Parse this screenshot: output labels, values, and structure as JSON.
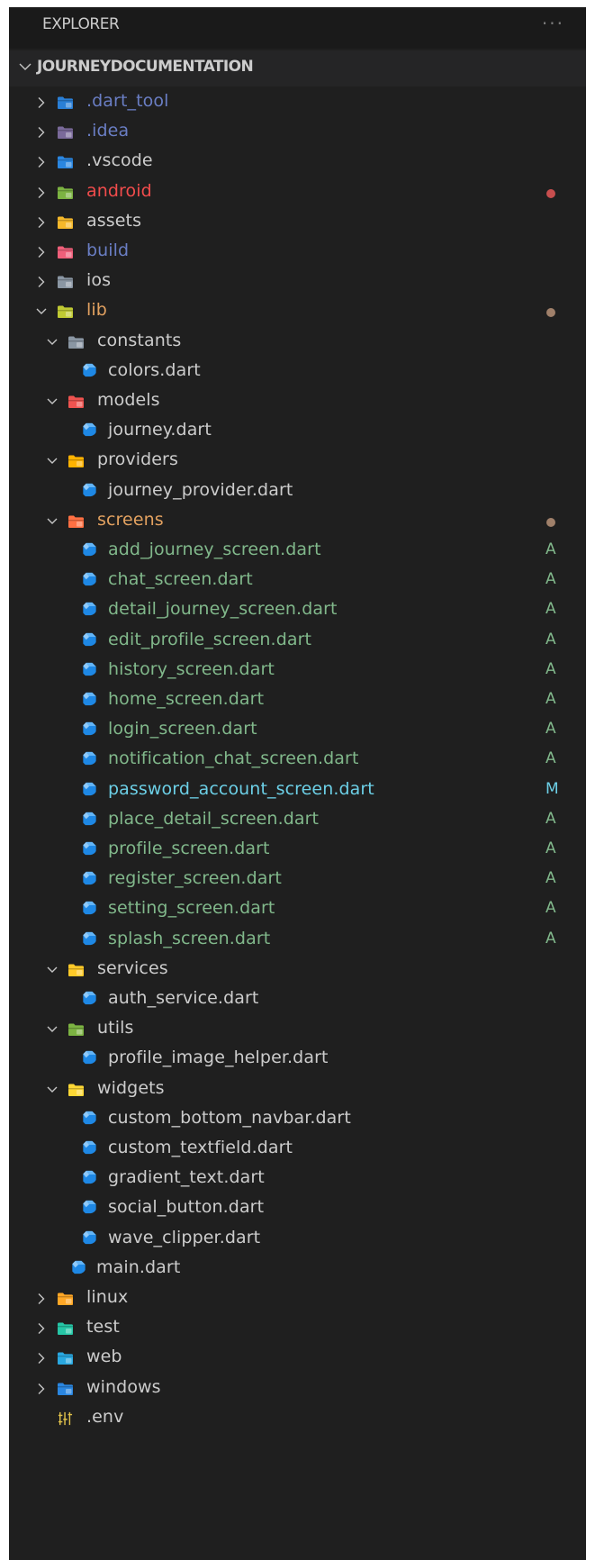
{
  "header": {
    "title": "EXPLORER",
    "more": "···"
  },
  "project": {
    "title": "JOURNEYDOCUMENTATION"
  },
  "colors": {
    "default": "#cccccc",
    "ignored": "#6a7ec4",
    "error": "#f14c4c",
    "modified_folder": "#e2a160",
    "added": "#81b88b",
    "modified": "#6ccfe6",
    "dot_error": "#c74e4e",
    "dot_modified": "#a0806a"
  },
  "tree": [
    {
      "label": ".dart_tool",
      "depth": 0,
      "folder": true,
      "expanded": false,
      "icon": "dart-tool-folder-icon",
      "icon_color": "#2a7fd6",
      "status": "ignored"
    },
    {
      "label": ".idea",
      "depth": 0,
      "folder": true,
      "expanded": false,
      "icon": "idea-folder-icon",
      "icon_color": "#7a6a9a",
      "status": "ignored"
    },
    {
      "label": ".vscode",
      "depth": 0,
      "folder": true,
      "expanded": false,
      "icon": "vscode-folder-icon",
      "icon_color": "#2a86e0",
      "status": "default"
    },
    {
      "label": "android",
      "depth": 0,
      "folder": true,
      "expanded": false,
      "icon": "android-folder-icon",
      "icon_color": "#7cb342",
      "status": "error",
      "dot": "dot_error"
    },
    {
      "label": "assets",
      "depth": 0,
      "folder": true,
      "expanded": false,
      "icon": "assets-folder-icon",
      "icon_color": "#f5b82a",
      "status": "default"
    },
    {
      "label": "build",
      "depth": 0,
      "folder": true,
      "expanded": false,
      "icon": "build-folder-icon",
      "icon_color": "#ef5f7a",
      "status": "ignored"
    },
    {
      "label": "ios",
      "depth": 0,
      "folder": true,
      "expanded": false,
      "icon": "ios-folder-icon",
      "icon_color": "#8a96a3",
      "status": "default"
    },
    {
      "label": "lib",
      "depth": 0,
      "folder": true,
      "expanded": true,
      "icon": "lib-folder-icon",
      "icon_color": "#c0ca33",
      "status": "modified_folder",
      "dot": "dot_modified"
    },
    {
      "label": "constants",
      "depth": 1,
      "folder": true,
      "expanded": true,
      "icon": "constants-folder-icon",
      "icon_color": "#8a96a3",
      "status": "default"
    },
    {
      "label": "colors.dart",
      "depth": 2,
      "folder": false,
      "icon": "dart-file-icon",
      "status": "default"
    },
    {
      "label": "models",
      "depth": 1,
      "folder": true,
      "expanded": true,
      "icon": "models-folder-icon",
      "icon_color": "#ef5350",
      "status": "default"
    },
    {
      "label": "journey.dart",
      "depth": 2,
      "folder": false,
      "icon": "dart-file-icon",
      "status": "default"
    },
    {
      "label": "providers",
      "depth": 1,
      "folder": true,
      "expanded": true,
      "icon": "providers-folder-icon",
      "icon_color": "#ffb300",
      "status": "default"
    },
    {
      "label": "journey_provider.dart",
      "depth": 2,
      "folder": false,
      "icon": "dart-file-icon",
      "status": "default"
    },
    {
      "label": "screens",
      "depth": 1,
      "folder": true,
      "expanded": true,
      "icon": "screens-folder-icon",
      "icon_color": "#ff7043",
      "status": "modified_folder",
      "dot": "dot_modified"
    },
    {
      "label": "add_journey_screen.dart",
      "depth": 2,
      "folder": false,
      "icon": "dart-file-icon",
      "status": "added",
      "badge": "A"
    },
    {
      "label": "chat_screen.dart",
      "depth": 2,
      "folder": false,
      "icon": "dart-file-icon",
      "status": "added",
      "badge": "A"
    },
    {
      "label": "detail_journey_screen.dart",
      "depth": 2,
      "folder": false,
      "icon": "dart-file-icon",
      "status": "added",
      "badge": "A"
    },
    {
      "label": "edit_profile_screen.dart",
      "depth": 2,
      "folder": false,
      "icon": "dart-file-icon",
      "status": "added",
      "badge": "A"
    },
    {
      "label": "history_screen.dart",
      "depth": 2,
      "folder": false,
      "icon": "dart-file-icon",
      "status": "added",
      "badge": "A"
    },
    {
      "label": "home_screen.dart",
      "depth": 2,
      "folder": false,
      "icon": "dart-file-icon",
      "status": "added",
      "badge": "A"
    },
    {
      "label": "login_screen.dart",
      "depth": 2,
      "folder": false,
      "icon": "dart-file-icon",
      "status": "added",
      "badge": "A"
    },
    {
      "label": "notification_chat_screen.dart",
      "depth": 2,
      "folder": false,
      "icon": "dart-file-icon",
      "status": "added",
      "badge": "A"
    },
    {
      "label": "password_account_screen.dart",
      "depth": 2,
      "folder": false,
      "icon": "dart-file-icon",
      "status": "modified",
      "badge": "M"
    },
    {
      "label": "place_detail_screen.dart",
      "depth": 2,
      "folder": false,
      "icon": "dart-file-icon",
      "status": "added",
      "badge": "A"
    },
    {
      "label": "profile_screen.dart",
      "depth": 2,
      "folder": false,
      "icon": "dart-file-icon",
      "status": "added",
      "badge": "A"
    },
    {
      "label": "register_screen.dart",
      "depth": 2,
      "folder": false,
      "icon": "dart-file-icon",
      "status": "added",
      "badge": "A"
    },
    {
      "label": "setting_screen.dart",
      "depth": 2,
      "folder": false,
      "icon": "dart-file-icon",
      "status": "added",
      "badge": "A"
    },
    {
      "label": "splash_screen.dart",
      "depth": 2,
      "folder": false,
      "icon": "dart-file-icon",
      "status": "added",
      "badge": "A"
    },
    {
      "label": "services",
      "depth": 1,
      "folder": true,
      "expanded": true,
      "icon": "services-folder-icon",
      "icon_color": "#ffca28",
      "status": "default"
    },
    {
      "label": "auth_service.dart",
      "depth": 2,
      "folder": false,
      "icon": "dart-file-icon",
      "status": "default"
    },
    {
      "label": "utils",
      "depth": 1,
      "folder": true,
      "expanded": true,
      "icon": "utils-folder-icon",
      "icon_color": "#7cb342",
      "status": "default"
    },
    {
      "label": "profile_image_helper.dart",
      "depth": 2,
      "folder": false,
      "icon": "dart-file-icon",
      "status": "default"
    },
    {
      "label": "widgets",
      "depth": 1,
      "folder": true,
      "expanded": true,
      "icon": "widgets-folder-icon",
      "icon_color": "#fdd835",
      "status": "default"
    },
    {
      "label": "custom_bottom_navbar.dart",
      "depth": 2,
      "folder": false,
      "icon": "dart-file-icon",
      "status": "default"
    },
    {
      "label": "custom_textfield.dart",
      "depth": 2,
      "folder": false,
      "icon": "dart-file-icon",
      "status": "default"
    },
    {
      "label": "gradient_text.dart",
      "depth": 2,
      "folder": false,
      "icon": "dart-file-icon",
      "status": "default"
    },
    {
      "label": "social_button.dart",
      "depth": 2,
      "folder": false,
      "icon": "dart-file-icon",
      "status": "default"
    },
    {
      "label": "wave_clipper.dart",
      "depth": 2,
      "folder": false,
      "icon": "dart-file-icon",
      "status": "default"
    },
    {
      "label": "main.dart",
      "depth": 1,
      "folder": false,
      "icon": "dart-file-icon",
      "status": "default"
    },
    {
      "label": "linux",
      "depth": 0,
      "folder": true,
      "expanded": false,
      "icon": "linux-folder-icon",
      "icon_color": "#ffa726",
      "status": "default"
    },
    {
      "label": "test",
      "depth": 0,
      "folder": true,
      "expanded": false,
      "icon": "test-folder-icon",
      "icon_color": "#26c6a6",
      "status": "default"
    },
    {
      "label": "web",
      "depth": 0,
      "folder": true,
      "expanded": false,
      "icon": "web-folder-icon",
      "icon_color": "#29a8e0",
      "status": "default"
    },
    {
      "label": "windows",
      "depth": 0,
      "folder": true,
      "expanded": false,
      "icon": "windows-folder-icon",
      "icon_color": "#2a86e0",
      "status": "default"
    },
    {
      "label": ".env",
      "depth": 0,
      "folder": false,
      "icon": "env-file-icon",
      "icon_color": "#e0c14a",
      "status": "default"
    }
  ]
}
